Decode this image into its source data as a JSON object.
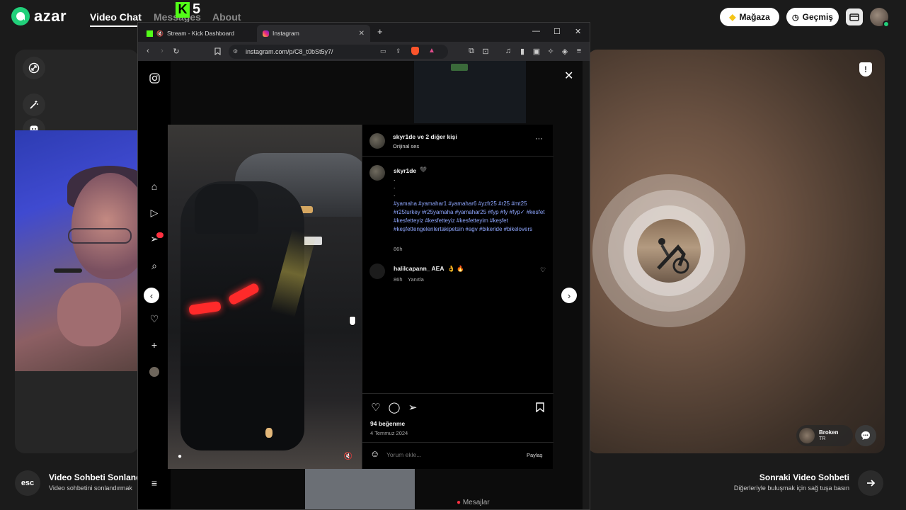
{
  "azar": {
    "logo_text": "azar",
    "nav": [
      "Video Chat",
      "Messages",
      "About"
    ],
    "kick_badge": "5",
    "store_label": "Mağaza",
    "history_label": "Geçmiş"
  },
  "browser": {
    "tabs": [
      {
        "label": "Stream - Kick Dashboard",
        "favicon": "kick-icon"
      },
      {
        "label": "Instagram",
        "favicon": "instagram-icon"
      }
    ],
    "url": "instagram.com/p/C8_t0bSt5y7/"
  },
  "post": {
    "header_user": "skyr1de ve 2 diğer kişi",
    "header_audio": "Orijinal ses",
    "caption_user": "skyr1de",
    "caption_dots": [
      ".",
      ".",
      "."
    ],
    "hashtags": "#yamaha #yamahar1 #yamahar6 #yzfr25 #r25 #mt25 #r25turkey #r25yamaha #yamahar25 #fyp #fy #fyp✓ #kesfet #kesfetteyiz #kesfetteyiz #kesfetteyim #keşfet #keşfettengelenlertakipetsin #agv #bikeride #bikelovers",
    "caption_time": "86h",
    "comment_user": "halilcapann_ AEA",
    "comment_emoji": "👌 🔥",
    "comment_time": "86h",
    "comment_reply": "Yanıtla",
    "likes": "94 beğenme",
    "date": "4 Temmuz 2024",
    "comment_placeholder": "Yorum ekle...",
    "share_label": "Paylaş"
  },
  "ig_footer": {
    "messages_label": "Mesajlar"
  },
  "partner": {
    "name": "Broken",
    "country": "TR"
  },
  "bottom": {
    "esc_label": "esc",
    "end_title": "Video Sohbeti Sonlandı",
    "end_sub": "Video sohbetini sonlandırmak",
    "next_title": "Sonraki Video Sohbeti",
    "next_sub": "Diğerleriyle buluşmak için sağ tuşa basın"
  },
  "colors": {
    "azar_green": "#21d07a",
    "kick_green": "#53fc18",
    "hashtag_blue": "#8fa7ff"
  }
}
